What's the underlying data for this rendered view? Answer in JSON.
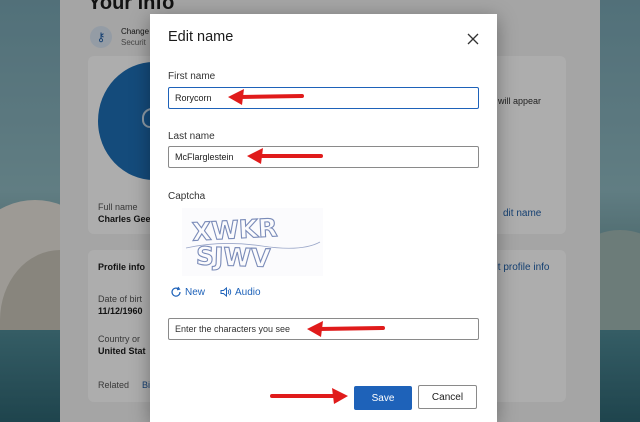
{
  "background": {
    "title": "Your info",
    "security_row": {
      "change": "Change",
      "security": "Securit"
    },
    "appear_text": "will appear",
    "full_name_label": "Full name",
    "full_name": "Charles Gee",
    "edit_name_link": "dit name",
    "profile_info_heading": "Profile info",
    "edit_profile_link": "dit profile info",
    "dob_label": "Date of birt",
    "dob": "11/12/1960",
    "country_label": "Country or",
    "country": "United Stat",
    "related_label": "Related",
    "related_link": "Bi"
  },
  "dialog": {
    "title": "Edit name",
    "first_name_label": "First name",
    "first_name_value": "Rorycorn",
    "last_name_label": "Last name",
    "last_name_value": "McFlarglestein",
    "captcha_label": "Captcha",
    "captcha_text_line1": "XWKR",
    "captcha_text_line2": "SJWV",
    "new_label": "New",
    "audio_label": "Audio",
    "captcha_input_placeholder": "Enter the characters you see",
    "save_label": "Save",
    "cancel_label": "Cancel"
  },
  "colors": {
    "accent": "#1e62b9",
    "annotation_arrow": "#e01b1b"
  },
  "icons": [
    "key-icon",
    "close-icon",
    "refresh-icon",
    "speaker-icon",
    "person-icon"
  ]
}
